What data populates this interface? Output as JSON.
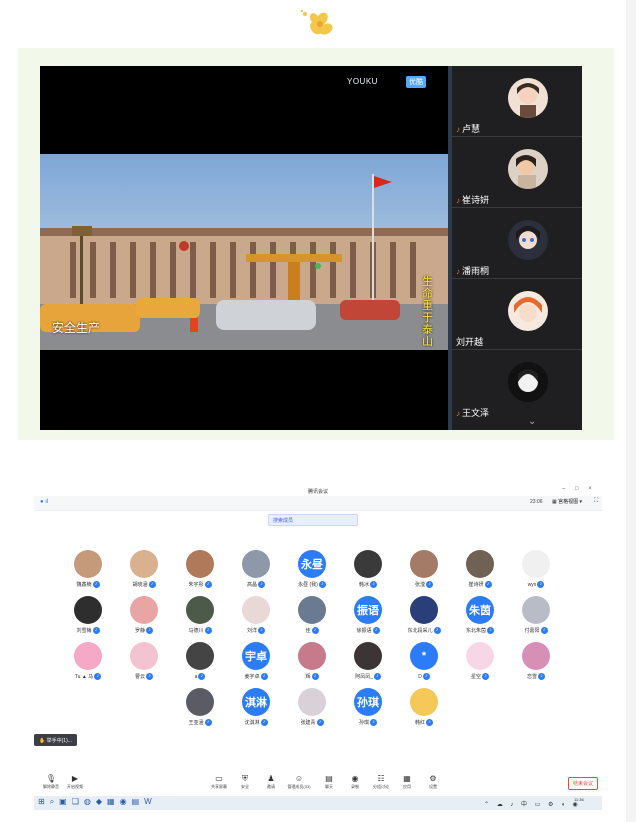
{
  "video": {
    "logo": "YOUKU",
    "logo_badge": "优酷",
    "caption_left": "安全生产",
    "caption_right": "生命重于泰山"
  },
  "sidebar": {
    "participants": [
      {
        "name": "卢慧"
      },
      {
        "name": "崔诗妍"
      },
      {
        "name": "潘雨桐"
      },
      {
        "name": "刘开越"
      },
      {
        "name": "王文泽"
      }
    ]
  },
  "meeting": {
    "title": "腾讯会议",
    "window_controls": "– □ ×",
    "timer": "23:06",
    "view_label": "宫格视图",
    "search_placeholder": "搜索成员",
    "participants": [
      {
        "name": "魏鑫楠",
        "avatar_text": ""
      },
      {
        "name": "胡晓涵",
        "avatar_text": ""
      },
      {
        "name": "朱宇彤",
        "avatar_text": ""
      },
      {
        "name": "高晶",
        "avatar_text": ""
      },
      {
        "name": "永昼 (我)",
        "avatar_text": "永昼"
      },
      {
        "name": "韩冰",
        "avatar_text": ""
      },
      {
        "name": "张滢",
        "avatar_text": ""
      },
      {
        "name": "崔诗妍",
        "avatar_text": ""
      },
      {
        "name": "wyx",
        "avatar_text": ""
      },
      {
        "name": "刘雪梅",
        "avatar_text": ""
      },
      {
        "name": "罗静",
        "avatar_text": ""
      },
      {
        "name": "马德川",
        "avatar_text": ""
      },
      {
        "name": "刘洋",
        "avatar_text": ""
      },
      {
        "name": "佳",
        "avatar_text": ""
      },
      {
        "name": "徐振语",
        "avatar_text": "振语"
      },
      {
        "name": "东北段采儿",
        "avatar_text": ""
      },
      {
        "name": "东北朱茵",
        "avatar_text": "朱茵"
      },
      {
        "name": "付嘉阳",
        "avatar_text": ""
      },
      {
        "name": "Tu ▲ 马",
        "avatar_text": ""
      },
      {
        "name": "曹云",
        "avatar_text": ""
      },
      {
        "name": "a",
        "avatar_text": ""
      },
      {
        "name": "姜宇卓",
        "avatar_text": "宇卓"
      },
      {
        "name": "辉",
        "avatar_text": ""
      },
      {
        "name": "阿凤凤_",
        "avatar_text": ""
      },
      {
        "name": "D",
        "avatar_text": "*"
      },
      {
        "name": "星空",
        "avatar_text": ""
      },
      {
        "name": "恋雪",
        "avatar_text": ""
      },
      {
        "name": "王亚涵",
        "avatar_text": ""
      },
      {
        "name": "沈淇淋",
        "avatar_text": "淇淋"
      },
      {
        "name": "张建青",
        "avatar_text": ""
      },
      {
        "name": "孙琪",
        "avatar_text": "孙琪"
      },
      {
        "name": "韩红",
        "avatar_text": ""
      }
    ],
    "hand_tip": "举手中(1)...",
    "toolbar": [
      {
        "label": "解除静音",
        "icon": "mic-icon"
      },
      {
        "label": "开启视频",
        "icon": "camera-icon"
      },
      {
        "label": "共享屏幕",
        "icon": "share-screen-icon"
      },
      {
        "label": "安全",
        "icon": "shield-icon"
      },
      {
        "label": "邀请",
        "icon": "invite-icon"
      },
      {
        "label": "管理成员(33)",
        "icon": "members-icon"
      },
      {
        "label": "聊天",
        "icon": "chat-icon"
      },
      {
        "label": "录制",
        "icon": "record-icon"
      },
      {
        "label": "分组讨论",
        "icon": "breakout-icon"
      },
      {
        "label": "应用",
        "icon": "apps-icon"
      },
      {
        "label": "设置",
        "icon": "settings-icon"
      }
    ],
    "end_button": "结束会议",
    "clock": "11:36"
  },
  "colors": {
    "accent_blue": "#2b7cf6",
    "end_red": "#e74c3c",
    "panel_bg": "#f2f8ea"
  }
}
